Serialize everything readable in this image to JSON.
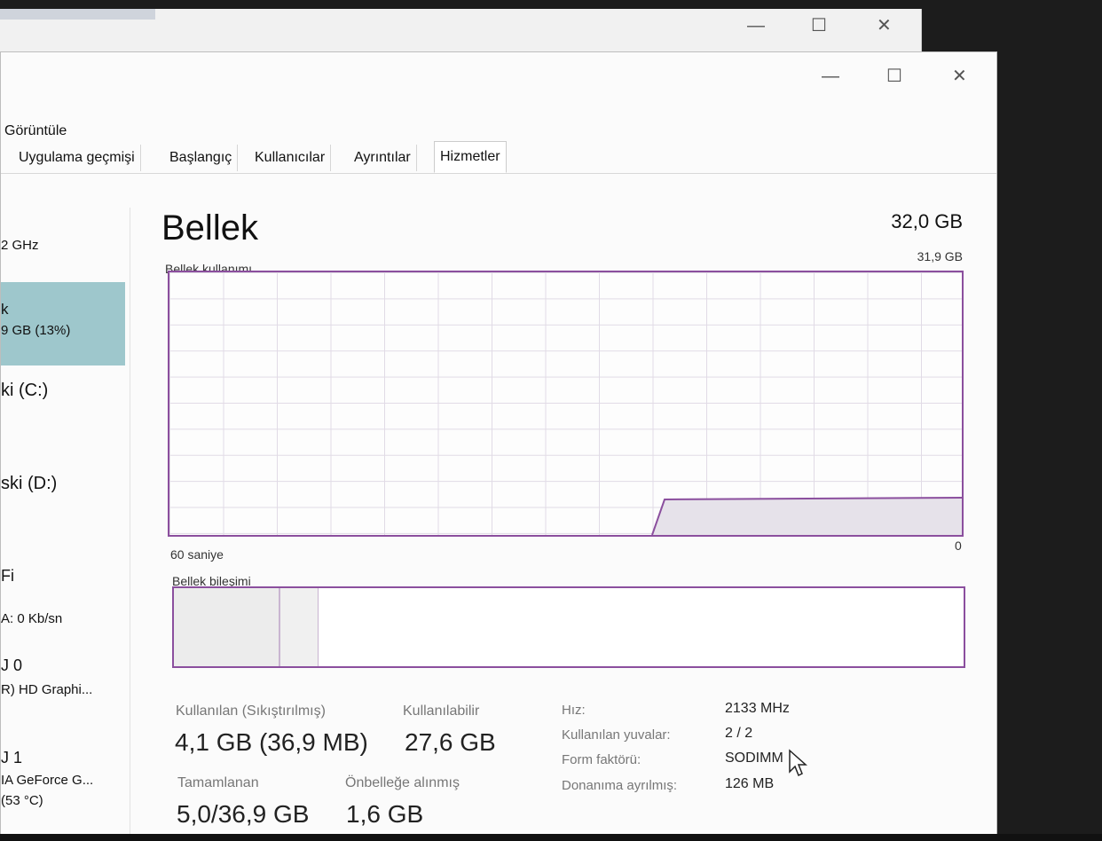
{
  "window": {
    "minimize": "—",
    "maximize": "☐",
    "close": "✕"
  },
  "menu": {
    "view": "Görüntüle"
  },
  "tabs": [
    "Uygulama geçmişi",
    "Başlangıç",
    "Kullanıcılar",
    "Ayrıntılar",
    "Hizmetler"
  ],
  "sidebar": {
    "cpu_speed": "2 GHz",
    "memory_name": "k",
    "memory_usage": "9 GB (13%)",
    "disk_c": "ki (C:)",
    "disk_d": "ski (D:)",
    "wifi_name": "Fi",
    "wifi_rate": "A: 0 Kb/sn",
    "gpu0_name": "J 0",
    "gpu0_desc": "R) HD Graphi...",
    "gpu1_name": "J 1",
    "gpu1_desc": "IA GeForce G...",
    "gpu1_temp": "(53 °C)"
  },
  "main": {
    "title": "Bellek",
    "total": "32,0 GB",
    "usage_label": "Bellek kullanımı",
    "usage_max": "31,9 GB",
    "time_label": "60 saniye",
    "time_zero": "0",
    "composition_label": "Bellek bileşimi"
  },
  "stats": {
    "used_label": "Kullanılan (Sıkıştırılmış)",
    "used_value": "4,1 GB (36,9 MB)",
    "available_label": "Kullanılabilir",
    "available_value": "27,6 GB",
    "committed_label": "Tamamlanan",
    "committed_value": "5,0/36,9 GB",
    "cached_label": "Önbelleğe alınmış",
    "cached_value": "1,6 GB"
  },
  "details": {
    "speed_label": "Hız:",
    "speed_value": "2133 MHz",
    "slots_label": "Kullanılan yuvalar:",
    "slots_value": "2 / 2",
    "form_label": "Form faktörü:",
    "form_value": "SODIMM",
    "reserved_label": "Donanıma ayrılmış:",
    "reserved_value": "126 MB"
  },
  "colors": {
    "accent": "#8b4f9e",
    "selected": "#9ec7cc"
  }
}
